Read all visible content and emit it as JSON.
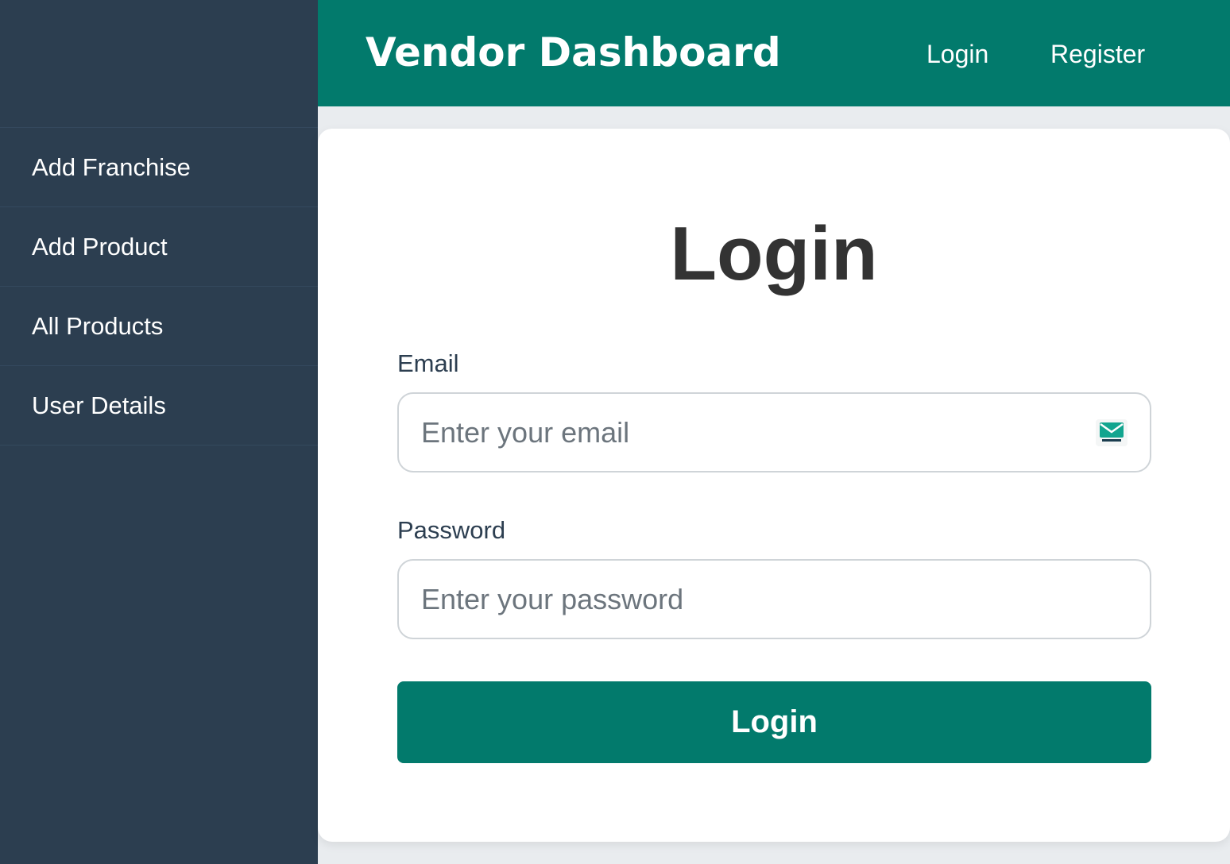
{
  "sidebar": {
    "items": [
      {
        "label": "Add Franchise"
      },
      {
        "label": "Add Product"
      },
      {
        "label": "All Products"
      },
      {
        "label": "User Details"
      }
    ]
  },
  "header": {
    "brand": "Vendor Dashboard",
    "nav": {
      "login": "Login",
      "register": "Register"
    },
    "accent_color": "#027a6c"
  },
  "login_form": {
    "title": "Login",
    "email": {
      "label": "Email",
      "placeholder": "Enter your email",
      "value": "",
      "icon": "tempmail-icon"
    },
    "password": {
      "label": "Password",
      "placeholder": "Enter your password",
      "value": ""
    },
    "submit_label": "Login"
  },
  "colors": {
    "sidebar_bg": "#2c3e50",
    "primary": "#027a6c",
    "text_dark": "#333333"
  }
}
